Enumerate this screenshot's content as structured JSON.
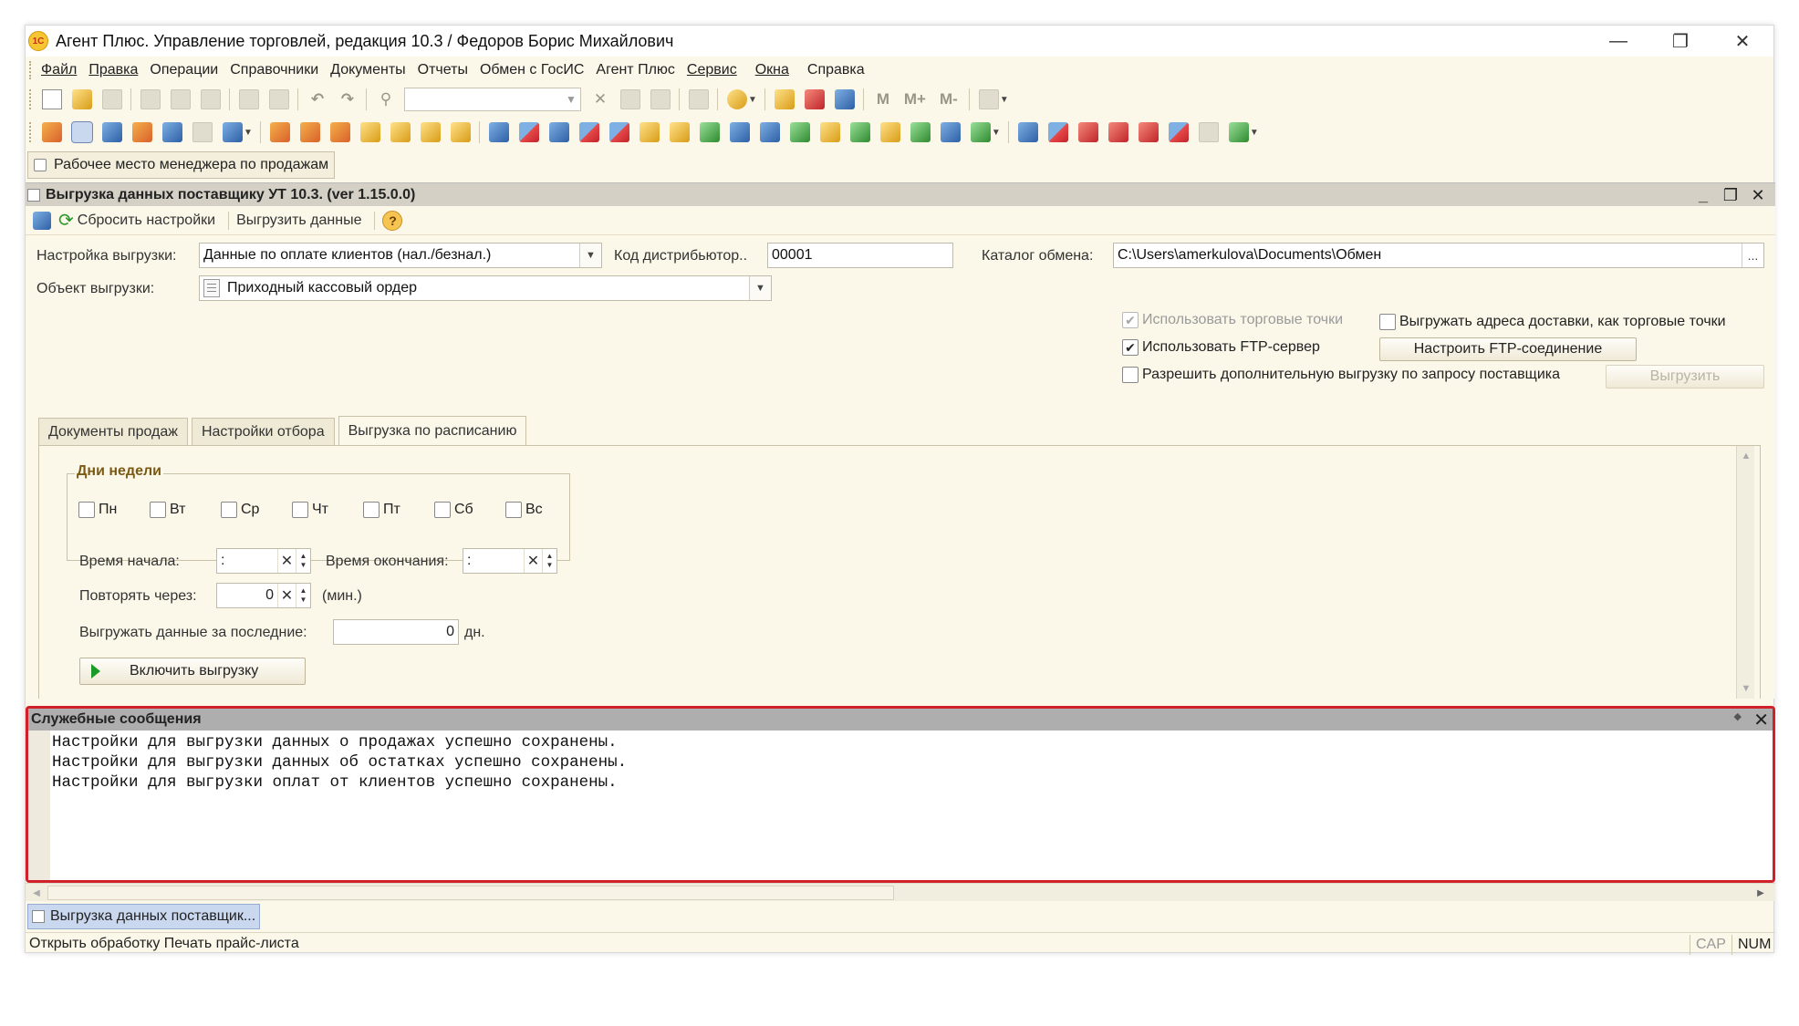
{
  "window": {
    "title": "Агент Плюс. Управление торговлей, редакция 10.3 / Федоров Борис Михайлович",
    "logo_text": "1С",
    "minimize": "—",
    "restore": "❐",
    "close": "✕"
  },
  "menu": [
    "Файл",
    "Правка",
    "Операции",
    "Справочники",
    "Документы",
    "Отчеты",
    "Обмен с ГосИС",
    "Агент Плюс",
    "Сервис",
    "Окна",
    "Справка"
  ],
  "workplace_tab": "Рабочее место менеджера по продажам",
  "form": {
    "title": "Выгрузка данных поставщику УТ 10.3. (ver 1.15.0.0)",
    "commands": {
      "reset": "Сбросить настройки",
      "export": "Выгрузить данные",
      "help": "?"
    },
    "export_setting_label": "Настройка выгрузки:",
    "export_setting_value": "Данные по оплате клиентов (нал./безнал.)",
    "distributor_code_label": "Код дистрибьютор..",
    "distributor_code_value": "00001",
    "exchange_catalog_label": "Каталог обмена:",
    "exchange_catalog_value": "C:\\Users\\amerkulova\\Documents\\Обмен",
    "export_object_label": "Объект выгрузки:",
    "export_object_value": "Приходный кассовый ордер",
    "use_trade_points": "Использовать торговые точки",
    "use_trade_points_checked": true,
    "use_ftp": "Использовать FTP-сервер",
    "use_ftp_checked": true,
    "allow_extra": "Разрешить дополнительную выгрузку по запросу поставщика",
    "allow_extra_checked": false,
    "export_addresses": "Выгружать адреса доставки, как торговые точки",
    "export_addresses_checked": false,
    "setup_ftp_button": "Настроить FTP-соединение",
    "export_button": "Выгрузить"
  },
  "tabs": [
    "Документы продаж",
    "Настройки отбора",
    "Выгрузка по расписанию"
  ],
  "active_tab": 2,
  "schedule": {
    "weekdays_title": "Дни недели",
    "weekdays": [
      "Пн",
      "Вт",
      "Ср",
      "Чт",
      "Пт",
      "Сб",
      "Вс"
    ],
    "start_time_label": "Время начала:",
    "start_time_value": ":",
    "end_time_label": "Время окончания:",
    "end_time_value": ":",
    "repeat_label": "Повторять через:",
    "repeat_value": "0",
    "repeat_unit": "(мин.)",
    "last_days_label": "Выгружать данные за последние:",
    "last_days_value": "0",
    "last_days_unit": "дн.",
    "enable_button": "Включить выгрузку"
  },
  "messages": {
    "title": "Служебные сообщения",
    "lines": [
      "Настройки для выгрузки данных о продажах успешно сохранены.",
      "Настройки для выгрузки данных об остатках успешно сохранены.",
      "Настройки для выгрузки оплат от клиентов успешно сохранены."
    ],
    "highlight_color": "#d2202b"
  },
  "taskbar_item": "Выгрузка данных поставщик...",
  "status": {
    "text": "Открыть обработку Печать прайс-листа",
    "cap": "CAP",
    "num": "NUM"
  },
  "toolbar_glyphs": {
    "m": "M",
    "m_plus": "M+",
    "m_minus": "M-"
  }
}
